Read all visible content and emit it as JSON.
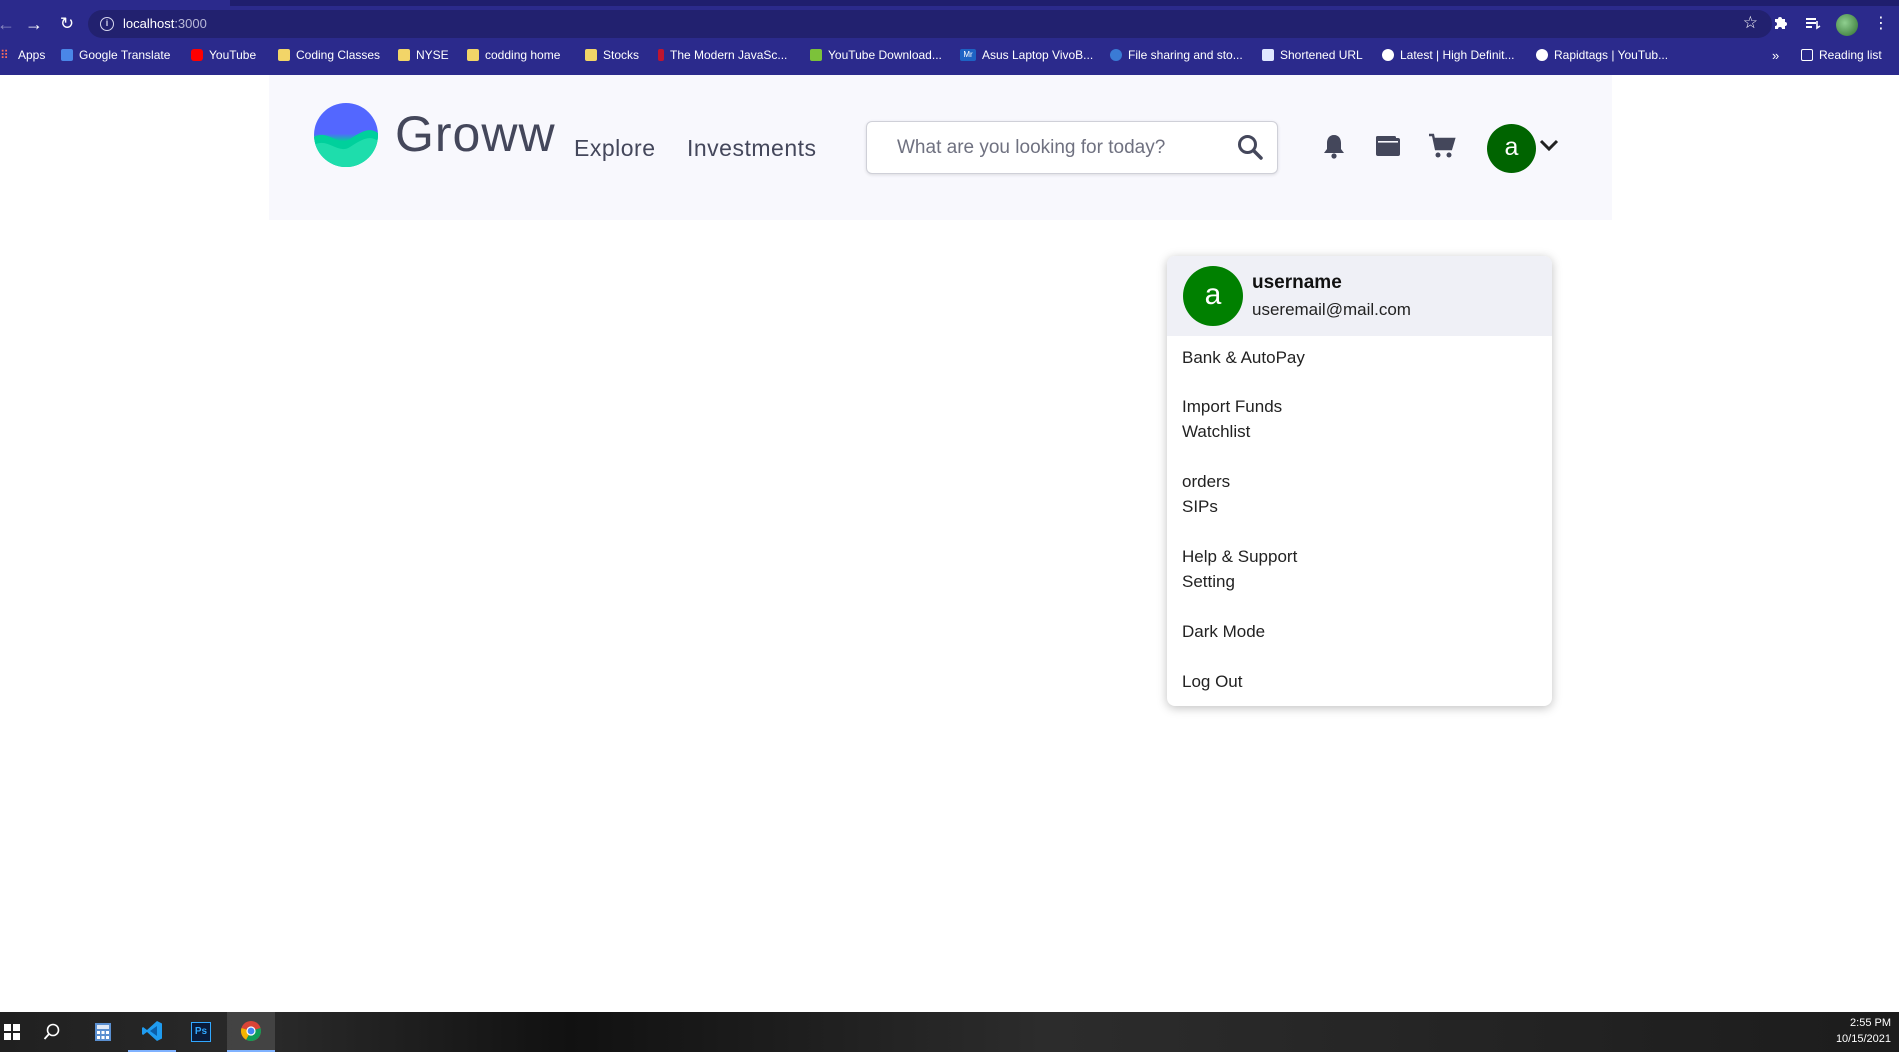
{
  "browser": {
    "url_host": "localhost",
    "url_port": ":3000",
    "bookmarks": [
      {
        "label": "Apps",
        "icon": "apps-grid-icon"
      },
      {
        "label": "Google Translate",
        "icon": "google-translate-icon"
      },
      {
        "label": "YouTube",
        "icon": "youtube-icon"
      },
      {
        "label": "Coding Classes",
        "icon": "folder-icon"
      },
      {
        "label": "NYSE",
        "icon": "folder-icon"
      },
      {
        "label": "codding home",
        "icon": "folder-icon"
      },
      {
        "label": "Stocks",
        "icon": "folder-icon"
      },
      {
        "label": "The Modern JavaSc...",
        "icon": "site-icon"
      },
      {
        "label": "YouTube Download...",
        "icon": "download-icon"
      },
      {
        "label": "Asus Laptop VivoB...",
        "icon": "mr-icon"
      },
      {
        "label": "File sharing and sto...",
        "icon": "site-icon"
      },
      {
        "label": "Shortened URL",
        "icon": "site-icon"
      },
      {
        "label": "Latest | High Definit...",
        "icon": "globe-icon"
      },
      {
        "label": "Rapidtags | YouTub...",
        "icon": "globe-icon"
      }
    ],
    "overflow": "»",
    "reading_list": "Reading list"
  },
  "header": {
    "brand": "Groww",
    "nav": [
      "Explore",
      "Investments"
    ],
    "search_placeholder": "What are you looking for today?",
    "avatar_letter": "a"
  },
  "dropdown": {
    "avatar_letter": "a",
    "username": "username",
    "email": "useremail@mail.com",
    "items": [
      "Bank & AutoPay",
      "Import Funds",
      "Watchlist",
      "orders",
      "SIPs",
      "Help & Support",
      "Setting",
      "Dark Mode",
      "Log Out"
    ]
  },
  "taskbar": {
    "time": "2:55 PM",
    "date": "10/15/2021"
  },
  "colors": {
    "chrome": "#2b2a8c",
    "brand_blue": "#5367ff",
    "brand_green": "#00d09c",
    "avatar_green": "#006400"
  }
}
